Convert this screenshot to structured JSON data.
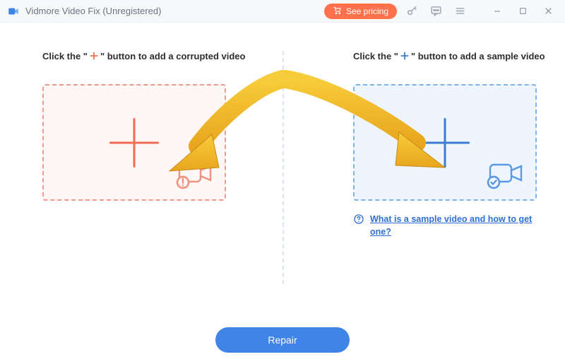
{
  "titlebar": {
    "app_title": "Vidmore Video Fix (Unregistered)",
    "pricing_label": "See pricing"
  },
  "left": {
    "instruction_pre": "Click the \"",
    "instruction_post": "\" button to add a corrupted video",
    "plus_color": "#f06b52"
  },
  "right": {
    "instruction_pre": "Click the \"",
    "instruction_post": "\" button to add a sample video",
    "plus_color": "#3a7ed0",
    "help_link": "What is a sample video and how to get one?"
  },
  "footer": {
    "repair_label": "Repair"
  }
}
